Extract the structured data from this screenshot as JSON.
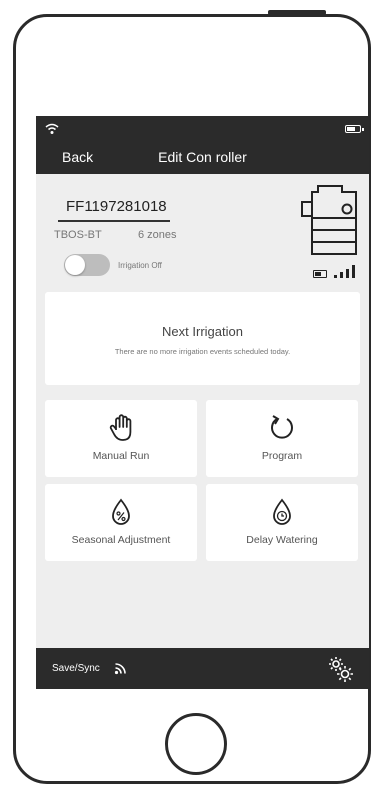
{
  "header": {
    "back_label": "Back",
    "title": "Edit Con roller"
  },
  "controller": {
    "serial": "FF1197281018",
    "model": "TBOS-BT",
    "zones": "6 zones",
    "irrigation_label": "Irrigation Off",
    "irrigation_on": false
  },
  "next_irrigation": {
    "title": "Next Irrigation",
    "message": "There are no more irrigation events scheduled today."
  },
  "actions": [
    {
      "label": "Manual Run",
      "icon": "hand-icon"
    },
    {
      "label": "Program",
      "icon": "refresh-icon"
    },
    {
      "label": "Seasonal Adjustment",
      "icon": "water-drop-percent-icon"
    },
    {
      "label": "Delay Watering",
      "icon": "water-drop-clock-icon"
    }
  ],
  "footer": {
    "save_label": "Save/Sync"
  },
  "colors": {
    "bar": "#2b2b2b",
    "screen_bg": "#eeeeee",
    "card_bg": "#ffffff"
  }
}
